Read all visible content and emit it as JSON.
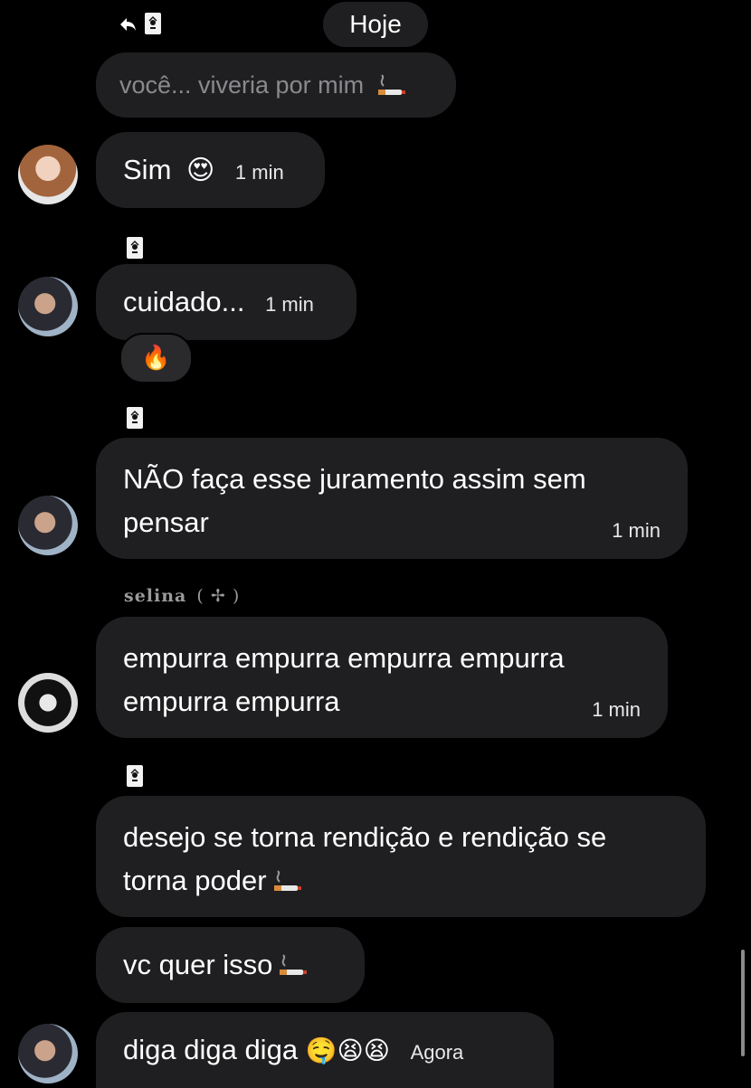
{
  "top": {
    "date_label": "Hoje"
  },
  "messages": [
    {
      "id": "reply-preview",
      "text": "você... viveria por mim"
    },
    {
      "id": "m1",
      "text": "Sim",
      "emoji": "😍",
      "time": "1 min"
    },
    {
      "id": "m2",
      "text": "cuidado...",
      "time": "1 min",
      "reaction": "🔥"
    },
    {
      "id": "m3",
      "line1": "NÃO faça esse juramento assim sem",
      "line2": "pensar",
      "time": "1 min"
    },
    {
      "id": "m4",
      "sender": "selina",
      "sender_suffix": "( ✢ )",
      "line1": "empurra empurra empurra empurra",
      "line2": "empurra empurra",
      "time": "1 min"
    },
    {
      "id": "m5",
      "line1": "desejo se torna rendição e rendição se",
      "line2": "torna poder"
    },
    {
      "id": "m6",
      "text": "vc quer isso"
    },
    {
      "id": "m7",
      "text": "diga diga diga",
      "emojis": "🤤😫😫",
      "time": "Agora"
    }
  ],
  "colors": {
    "background": "#000000",
    "bubble": "#1f1f21",
    "text": "#ffffff",
    "muted": "#8a8a8e"
  }
}
